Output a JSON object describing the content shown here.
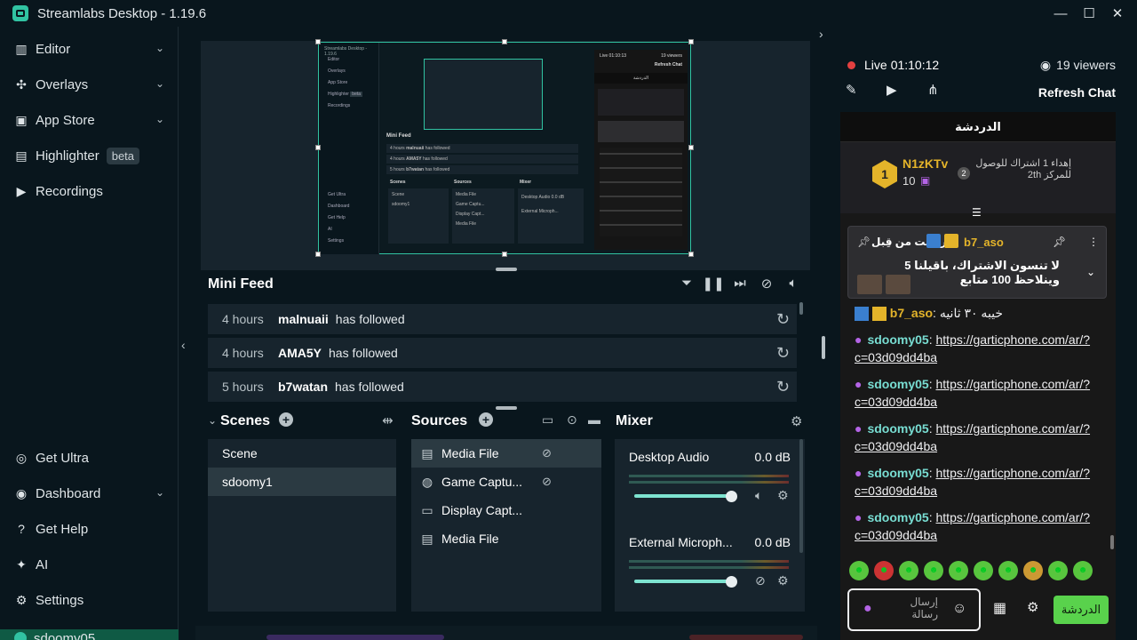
{
  "app": {
    "title": "Streamlabs Desktop - 1.19.6"
  },
  "window_controls": {
    "minimize": "—",
    "maximize": "☐",
    "close": "✕"
  },
  "sidebar": {
    "items": [
      {
        "label": "Editor",
        "icon": "editor-icon",
        "chevron": "⌄"
      },
      {
        "label": "Overlays",
        "icon": "overlays-icon",
        "chevron": "⌄"
      },
      {
        "label": "App Store",
        "icon": "store-icon",
        "chevron": "⌄"
      },
      {
        "label": "Highlighter",
        "icon": "highlighter-icon",
        "badge": "beta"
      },
      {
        "label": "Recordings",
        "icon": "recordings-icon"
      }
    ],
    "bottom_items": [
      {
        "label": "Get Ultra",
        "icon": "ultra-icon"
      },
      {
        "label": "Dashboard",
        "icon": "dashboard-icon",
        "chevron": "⌄"
      },
      {
        "label": "Get Help",
        "icon": "help-icon"
      },
      {
        "label": "AI",
        "icon": "ai-icon"
      },
      {
        "label": "Settings",
        "icon": "settings-icon"
      }
    ],
    "user": "sdoomy05"
  },
  "mini_feed": {
    "title": "Mini Feed",
    "rows": [
      {
        "time": "4 hours",
        "user": "malnuaii",
        "action": "has followed"
      },
      {
        "time": "4 hours",
        "user": "AMA5Y",
        "action": "has followed"
      },
      {
        "time": "5 hours",
        "user": "b7watan",
        "action": "has followed"
      }
    ]
  },
  "scenes": {
    "title": "Scenes",
    "items": [
      "Scene",
      "sdoomy1"
    ],
    "selected": "sdoomy1"
  },
  "sources": {
    "title": "Sources",
    "items": [
      "Media File",
      "Game Captu...",
      "Display Capt...",
      "Media File"
    ]
  },
  "mixer": {
    "title": "Mixer",
    "channels": [
      {
        "name": "Desktop Audio",
        "db": "0.0 dB",
        "level": 1.0
      },
      {
        "name": "External Microph...",
        "db": "0.0 dB",
        "level": 1.0
      }
    ]
  },
  "preview_mini": {
    "title": "Streamlabs Desktop - 1.19.6",
    "nav": [
      "Editor",
      "Overlays",
      "App Store",
      "Highlighter",
      "Recordings",
      "Get Ultra",
      "Dashboard",
      "Get Help",
      "AI",
      "Settings"
    ],
    "highlighter_badge": "beta",
    "mini_feed_title": "Mini Feed",
    "feed": [
      {
        "time": "4 hours",
        "user": "malnuaii",
        "action": "has followed"
      },
      {
        "time": "4 hours",
        "user": "AMA5Y",
        "action": "has followed"
      },
      {
        "time": "5 hours",
        "user": "b7watan",
        "action": "has followed"
      }
    ],
    "scenes_title": "Scenes",
    "scenes": [
      "Scene",
      "sdoomy1"
    ],
    "sources_title": "Sources",
    "sources": [
      "Media File",
      "Game Captu...",
      "Display Capt...",
      "Media File"
    ],
    "mixer_title": "Mixer",
    "mixer": [
      "Desktop Audio",
      "External Microph..."
    ],
    "db": "0.0 dB",
    "live": "Live 01:10:13",
    "viewers": "19 viewers",
    "refresh": "Refresh Chat",
    "chat_tab": "الدردشة"
  },
  "stream": {
    "status": "Live",
    "time": "01:10:12",
    "viewers": "19 viewers",
    "refresh_label": "Refresh Chat"
  },
  "chat": {
    "tab": "الدردشة",
    "gift": {
      "user": "N1zKTv",
      "count": "10",
      "rank": "1",
      "rank2": "2",
      "text": "إهداء 1 اشتراك للوصول للمركز 2th"
    },
    "pinned": {
      "user": "b7_aso",
      "by_label": "أرسلت من قِبل",
      "text": "لا تنسون الاشتراك، باقيلنا 5 وينلاحظ 100 متابع"
    },
    "messages": [
      {
        "user": "b7_aso",
        "text": "خيبه ٣٠ ثانيه"
      },
      {
        "user": "sdoomy05",
        "text": "https://garticphone.com/ar/?c=03d09dd4ba"
      },
      {
        "user": "sdoomy05",
        "text": "https://garticphone.com/ar/?c=03d09dd4ba"
      },
      {
        "user": "sdoomy05",
        "text": "https://garticphone.com/ar/?c=03d09dd4ba"
      },
      {
        "user": "sdoomy05",
        "text": "https://garticphone.com/ar/?c=03d09dd4ba"
      },
      {
        "user": "sdoomy05",
        "text": "https://garticphone.com/ar/?c=03d09dd4ba"
      }
    ],
    "input_placeholder": "إرسال رسالة",
    "send_label": "الدردشة"
  },
  "colors": {
    "accent": "#31c3a2",
    "bg": "#09161d",
    "panel": "#17242d",
    "live": "#e34040",
    "send": "#59d24c"
  }
}
